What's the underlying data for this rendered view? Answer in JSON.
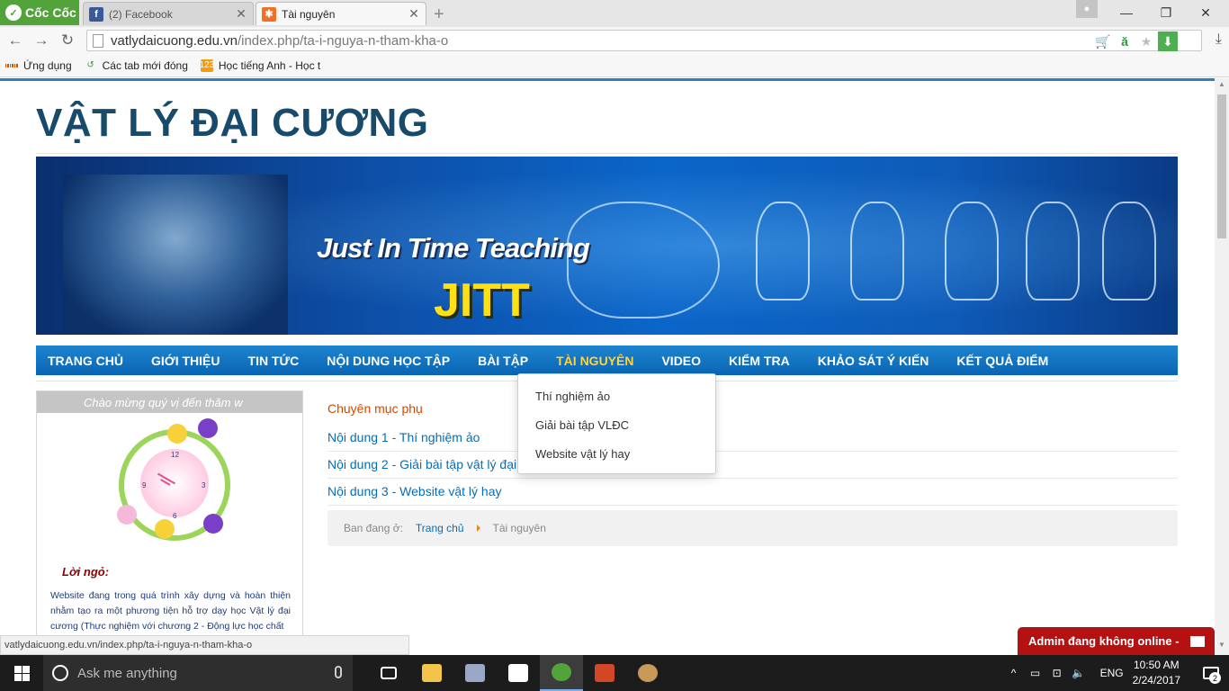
{
  "browser": {
    "brand_label": "Cốc Cốc",
    "tabs": [
      {
        "title": "(2) Facebook",
        "icon": "facebook-icon",
        "color": "#3b5998"
      },
      {
        "title": "Tài nguyên",
        "icon": "joomla-icon",
        "color": "#f46f25"
      }
    ],
    "url_domain": "vatlydaicuong.edu.vn",
    "url_path": "/index.php/ta-i-nguya-n-tham-kha-o",
    "bookmarks": [
      {
        "label": "Ứng dụng",
        "icon": "apps-grid-icon"
      },
      {
        "label": "Các tab mới đóng",
        "icon": "recent-tabs-icon"
      },
      {
        "label": "Học tiếng Anh - Học t",
        "icon": "123-icon"
      }
    ],
    "status_url": "vatlydaicuong.edu.vn/index.php/ta-i-nguya-n-tham-kha-o"
  },
  "site": {
    "title": "VẬT LÝ ĐẠI CƯƠNG",
    "banner": {
      "line1": "Just In Time Teaching",
      "line2": "JITT"
    },
    "nav": [
      {
        "label": "TRANG CHỦ",
        "active": false
      },
      {
        "label": "GIỚI THIỆU",
        "active": false
      },
      {
        "label": "TIN TỨC",
        "active": false
      },
      {
        "label": "NỘI DUNG HỌC TẬP",
        "active": false
      },
      {
        "label": "BÀI TẬP",
        "active": false
      },
      {
        "label": "TÀI NGUYÊN",
        "active": true
      },
      {
        "label": "VIDEO",
        "active": false
      },
      {
        "label": "KIỂM TRA",
        "active": false
      },
      {
        "label": "KHẢO SÁT Ý KIẾN",
        "active": false
      },
      {
        "label": "KẾT QUẢ ĐIỂM",
        "active": false
      }
    ],
    "dropdown": [
      "Thí nghiệm ảo",
      "Giải bài tập VLĐC",
      "Website vật lý hay"
    ],
    "left_module": {
      "marquee": "Chào mừng quý vị đến thăm w",
      "loi_ngo": "Lời ngỏ:",
      "intro": "Website đang trong quá trình xây dựng và hoàn thiện nhằm tạo ra một phương tiện hỗ trợ dạy học Vật lý đại cương (Thực nghiệm với chương 2 - Động lực học chất"
    },
    "subcategory_heading": "Chuyên mục phụ",
    "categories": [
      "Nội dung 1 - Thí nghiệm ảo",
      "Nội dung 2 - Giải bài tập vật lý đại c",
      "Nội dung 3 - Website vật lý hay"
    ],
    "breadcrumb": {
      "prefix": "Ban đang ở:",
      "home": "Trang chủ",
      "current": "Tài nguyên"
    },
    "chat": "Admin đang không online -"
  },
  "taskbar": {
    "search_placeholder": "Ask me anything",
    "language": "ENG",
    "time": "10:50 AM",
    "date": "2/24/2017",
    "notifications": "2"
  }
}
